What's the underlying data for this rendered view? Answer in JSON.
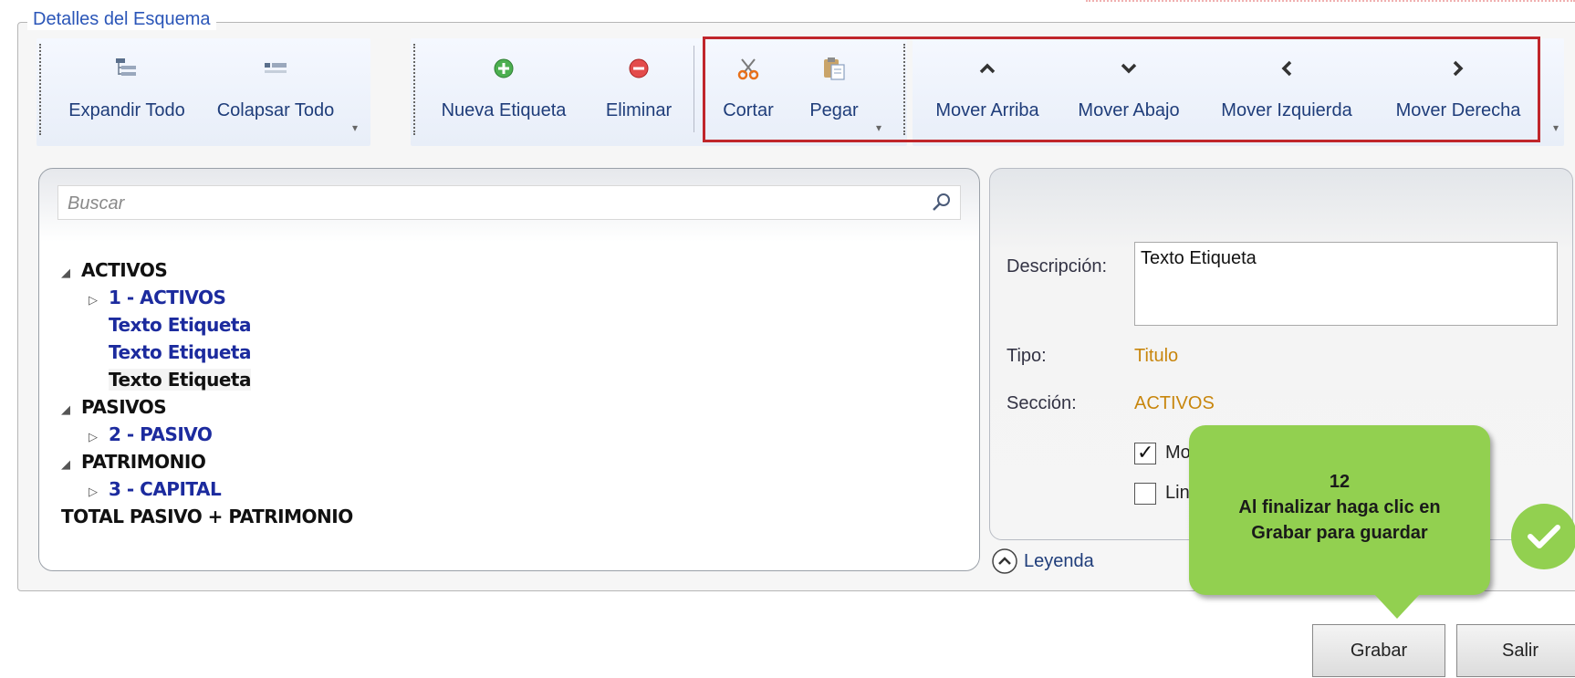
{
  "group_title": "Detalles del Esquema",
  "ribbon": {
    "expand_all": "Expandir Todo",
    "collapse_all": "Colapsar Todo",
    "new_label": "Nueva Etiqueta",
    "delete": "Eliminar",
    "cut": "Cortar",
    "paste": "Pegar",
    "move_up": "Mover Arriba",
    "move_down": "Mover Abajo",
    "move_left": "Mover Izquierda",
    "move_right": "Mover Derecha",
    "more_glyph": "▾"
  },
  "search": {
    "placeholder": "Buscar"
  },
  "tree": [
    {
      "text": "ACTIVOS",
      "toggle": "◢"
    },
    {
      "text": "1 - ACTIVOS",
      "toggle": "▷"
    },
    {
      "text": "Texto Etiqueta"
    },
    {
      "text": "Texto Etiqueta"
    },
    {
      "text": "Texto Etiqueta"
    },
    {
      "text": "PASIVOS",
      "toggle": "◢"
    },
    {
      "text": "2 - PASIVO",
      "toggle": "▷"
    },
    {
      "text": "PATRIMONIO",
      "toggle": "◢"
    },
    {
      "text": "3 - CAPITAL",
      "toggle": "▷"
    },
    {
      "text": "TOTAL PASIVO + PATRIMONIO"
    }
  ],
  "details": {
    "description_label": "Descripción:",
    "description_value": "Texto Etiqueta",
    "type_label": "Tipo:",
    "type_value": "Titulo",
    "section_label": "Sección:",
    "section_value": "ACTIVOS",
    "checkbox1_label": "Mo",
    "checkbox1_checked": true,
    "checkbox2_label": "Lin",
    "checkbox2_checked": false,
    "checkmark_glyph": "✓"
  },
  "legend_toggle": "Leyenda",
  "buttons": {
    "save": "Grabar",
    "exit": "Salir"
  },
  "callout": {
    "step": "12",
    "line1": "Al finalizar haga clic en",
    "line2": "Grabar para guardar"
  },
  "colors": {
    "accent_green": "#92d050",
    "highlight_red": "#c0262b",
    "tree_blue": "#1c2b9e",
    "value_orange": "#c8860d"
  }
}
